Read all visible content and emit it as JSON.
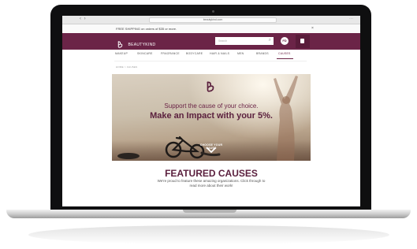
{
  "browser": {
    "address": "beautykind.com",
    "dot_colors": [
      "#ff5f57",
      "#febc2e",
      "#28c840"
    ]
  },
  "promo": {
    "text": "FREE SHIPPING on orders of $35 or more.",
    "close": "×"
  },
  "header": {
    "logo_text": "BEAUTYKIND",
    "search_placeholder": "Search",
    "account_initials": "FD",
    "brand_color": "#6b2447"
  },
  "nav": {
    "items": [
      {
        "label": "MAKEUP"
      },
      {
        "label": "SKINCARE"
      },
      {
        "label": "FRAGRANCE"
      },
      {
        "label": "BODYCARE"
      },
      {
        "label": "HAIR & NAILS"
      },
      {
        "label": "MEN"
      },
      {
        "label": "BRANDS"
      },
      {
        "label": "CAUSES"
      }
    ],
    "active": "CAUSES"
  },
  "breadcrumb": "HOME  >  CAUSES",
  "hero": {
    "tagline": "Support the cause of your choice.",
    "headline": "Make an Impact with your 5%.",
    "cta": "CHOOSE YOUR CAUSE"
  },
  "featured": {
    "title": "FEATURED CAUSES",
    "description": "We're proud to feature these amazing organizations. Click through to read more about their work!"
  }
}
